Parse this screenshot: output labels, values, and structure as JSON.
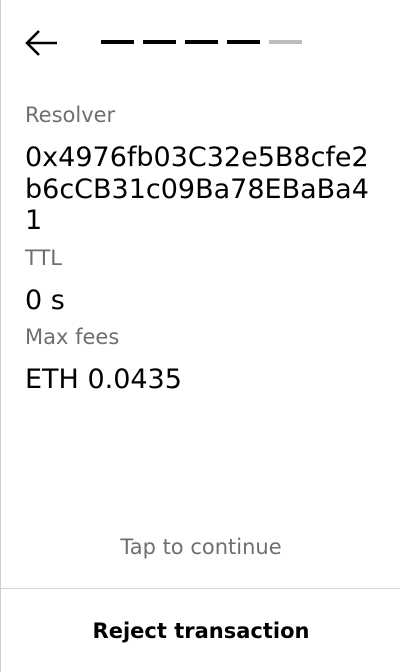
{
  "header": {
    "back_icon": "arrow-left-icon",
    "progress": {
      "total_steps": 5,
      "completed_steps": 4
    }
  },
  "fields": {
    "resolver": {
      "label": "Resolver",
      "value": "0x4976fb03C32e5B8cfe2b6cCB31c09Ba78EBaBa41"
    },
    "ttl": {
      "label": "TTL",
      "value": "0 s"
    },
    "max_fees": {
      "label": "Max fees",
      "value": "ETH 0.0435"
    }
  },
  "footer": {
    "hint": "Tap to continue",
    "reject_label": "Reject transaction"
  },
  "colors": {
    "text_primary": "#000000",
    "text_secondary": "#6f6f6f",
    "progress_active": "#000000",
    "progress_inactive": "#bdbdbd",
    "divider": "#d3d3d3"
  }
}
